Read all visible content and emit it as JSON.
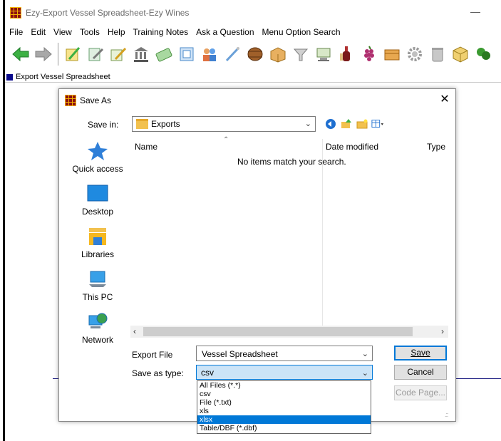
{
  "window": {
    "title": "Ezy-Export Vessel Spreadsheet-Ezy Wines",
    "minimize_glyph": "—"
  },
  "menu": [
    "File",
    "Edit",
    "View",
    "Tools",
    "Help",
    "Training Notes",
    "Ask a Question",
    "Menu Option Search"
  ],
  "toolbar_icons": [
    "back-arrow-icon",
    "forward-arrow-icon",
    "edit-note-icon",
    "notes-icon",
    "notes-edit-icon",
    "bank-icon",
    "money-icon",
    "document-icon",
    "users-icon",
    "pencil-icon",
    "barrel-icon",
    "box-edit-icon",
    "funnel-icon",
    "computer-icon",
    "bottle-icon",
    "grapes-icon",
    "crate-icon",
    "gear-icon",
    "bin-icon",
    "package-icon",
    "vine-icon"
  ],
  "child_window": {
    "title": "Export Vessel Spreadsheet"
  },
  "dialog": {
    "title": "Save As",
    "close_glyph": "✕",
    "save_in_label": "Save in:",
    "save_in_value": "Exports",
    "places": [
      {
        "label": "Quick access",
        "icon": "quick-access-star-icon"
      },
      {
        "label": "Desktop",
        "icon": "desktop-icon"
      },
      {
        "label": "Libraries",
        "icon": "libraries-icon"
      },
      {
        "label": "This PC",
        "icon": "this-pc-icon"
      },
      {
        "label": "Network",
        "icon": "network-icon"
      }
    ],
    "columns": {
      "name": "Name",
      "date": "Date modified",
      "type": "Type"
    },
    "empty_message": "No items match your search.",
    "export_file_label": "Export File",
    "export_file_value": "Vessel Spreadsheet",
    "save_as_type_label": "Save as type:",
    "save_as_type_value": "csv",
    "buttons": {
      "save": "Save",
      "cancel": "Cancel",
      "code_page": "Code Page..."
    },
    "type_options": [
      "All Files (*.*)",
      "csv",
      "File (*.txt)",
      "xls",
      "xlsx",
      "Table/DBF (*.dbf)"
    ],
    "highlighted_option": "xlsx"
  },
  "colors": {
    "accent": "#0078d7",
    "mdi_icon": "#0a0a8c",
    "logo_red": "#8b1010",
    "logo_yellow": "#f3b000"
  }
}
